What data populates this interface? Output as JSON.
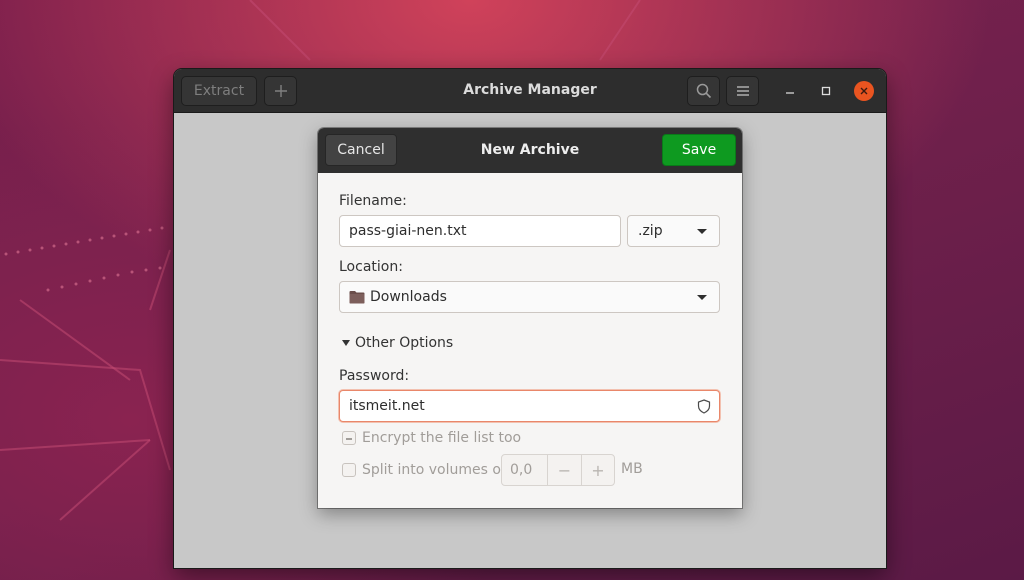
{
  "window": {
    "title": "Archive Manager",
    "extract_label": "Extract",
    "new_icon": "plus-icon",
    "search_icon": "search-icon",
    "menu_icon": "hamburger-menu-icon",
    "minimize_icon": "minimize-icon",
    "maximize_icon": "maximize-icon",
    "close_icon": "close-icon"
  },
  "dialog": {
    "title": "New Archive",
    "cancel_label": "Cancel",
    "save_label": "Save",
    "filename_label": "Filename:",
    "filename_value": "pass-giai-nen.txt",
    "extension_value": ".zip",
    "location_label": "Location:",
    "location_value": "Downloads",
    "location_icon": "folder-icon",
    "other_options_label": "Other Options",
    "password_label": "Password:",
    "password_value": "itsmeit.net",
    "password_icon": "shield-icon",
    "encrypt_label": "Encrypt the file list too",
    "split_label": "Split into volumes of",
    "split_value": "0,0",
    "split_unit": "MB",
    "spin_minus": "−",
    "spin_plus": "+"
  },
  "colors": {
    "save_button": "#0e9a20",
    "close_button": "#e95420",
    "password_focus": "#e9876a",
    "headerbar": "#2d2d2d"
  }
}
